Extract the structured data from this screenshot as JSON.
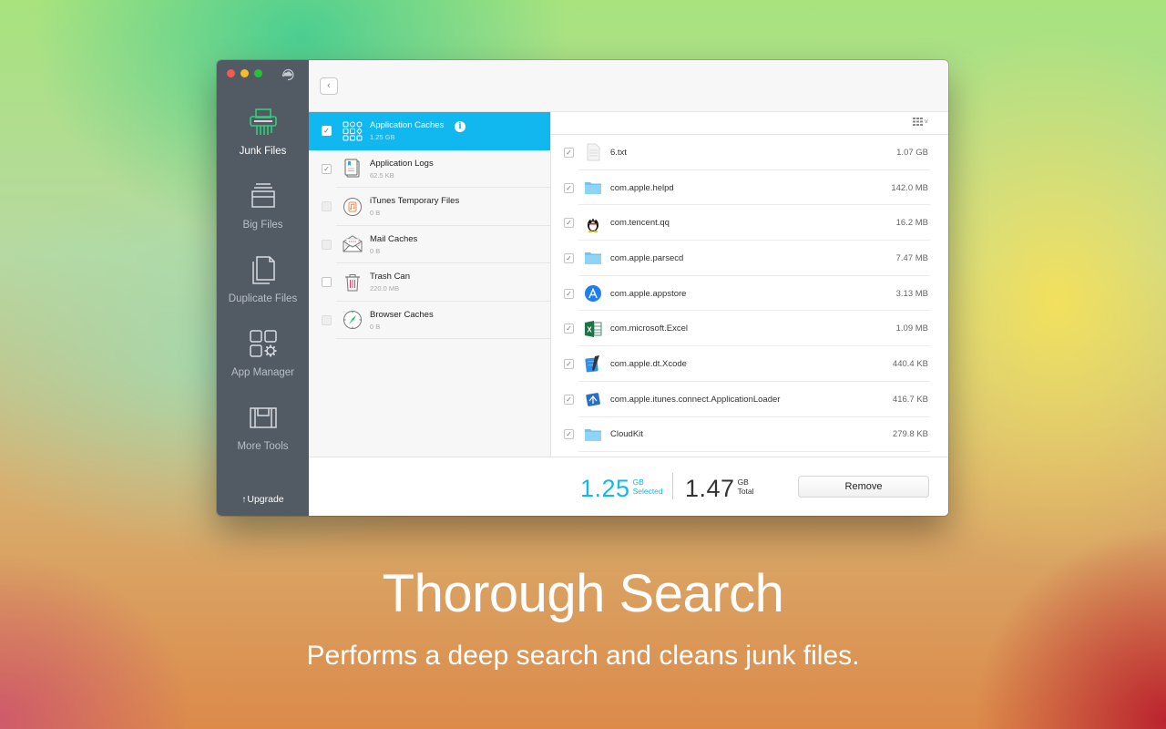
{
  "sidebar": {
    "items": [
      {
        "label": "Junk Files",
        "icon": "shredder-icon",
        "active": true
      },
      {
        "label": "Big Files",
        "icon": "drawer-icon",
        "active": false
      },
      {
        "label": "Duplicate Files",
        "icon": "duplicate-files-icon",
        "active": false
      },
      {
        "label": "App Manager",
        "icon": "app-manager-icon",
        "active": false
      },
      {
        "label": "More Tools",
        "icon": "toolbox-icon",
        "active": false
      }
    ],
    "upgrade_label": "Upgrade",
    "upgrade_arrow": "↑"
  },
  "toolbar": {
    "back_glyph": "‹"
  },
  "categories": [
    {
      "name": "Application Caches",
      "size": "1.25 GB",
      "checked": true,
      "selected": true,
      "enabled": true,
      "icon": "app-caches-icon"
    },
    {
      "name": "Application Logs",
      "size": "62.5 KB",
      "checked": true,
      "selected": false,
      "enabled": true,
      "icon": "logs-icon"
    },
    {
      "name": "iTunes Temporary Files",
      "size": "0 B",
      "checked": false,
      "selected": false,
      "enabled": false,
      "icon": "itunes-icon"
    },
    {
      "name": "Mail Caches",
      "size": "0 B",
      "checked": false,
      "selected": false,
      "enabled": false,
      "icon": "mail-icon"
    },
    {
      "name": "Trash Can",
      "size": "220.0 MB",
      "checked": false,
      "selected": false,
      "enabled": true,
      "icon": "trash-icon"
    },
    {
      "name": "Browser Caches",
      "size": "0 B",
      "checked": false,
      "selected": false,
      "enabled": false,
      "icon": "compass-icon"
    }
  ],
  "info_glyph": "i",
  "files_header": {
    "view_icon": "grid-view-icon",
    "chevron": "˅"
  },
  "files": [
    {
      "name": "6.txt",
      "size": "1.07 GB",
      "checked": true,
      "icon": "text-file-icon"
    },
    {
      "name": "com.apple.helpd",
      "size": "142.0 MB",
      "checked": true,
      "icon": "folder-icon"
    },
    {
      "name": "com.tencent.qq",
      "size": "16.2 MB",
      "checked": true,
      "icon": "qq-penguin-icon"
    },
    {
      "name": "com.apple.parsecd",
      "size": "7.47 MB",
      "checked": true,
      "icon": "folder-icon"
    },
    {
      "name": "com.apple.appstore",
      "size": "3.13 MB",
      "checked": true,
      "icon": "app-store-icon"
    },
    {
      "name": "com.microsoft.Excel",
      "size": "1.09 MB",
      "checked": true,
      "icon": "excel-icon"
    },
    {
      "name": "com.apple.dt.Xcode",
      "size": "440.4 KB",
      "checked": true,
      "icon": "xcode-icon"
    },
    {
      "name": "com.apple.itunes.connect.ApplicationLoader",
      "size": "416.7 KB",
      "checked": true,
      "icon": "application-loader-icon"
    },
    {
      "name": "CloudKit",
      "size": "279.8 KB",
      "checked": true,
      "icon": "folder-icon"
    }
  ],
  "footer": {
    "selected_value": "1.25",
    "selected_unit": "GB",
    "selected_label": "Selected",
    "total_value": "1.47",
    "total_unit": "GB",
    "total_label": "Total",
    "remove_label": "Remove"
  },
  "hero": {
    "title": "Thorough Search",
    "subtitle": "Performs a deep search and cleans junk files."
  },
  "colors": {
    "accent": "#11b8f0",
    "sidebar_bg": "#525a64",
    "active_icon": "#2fd07a"
  }
}
